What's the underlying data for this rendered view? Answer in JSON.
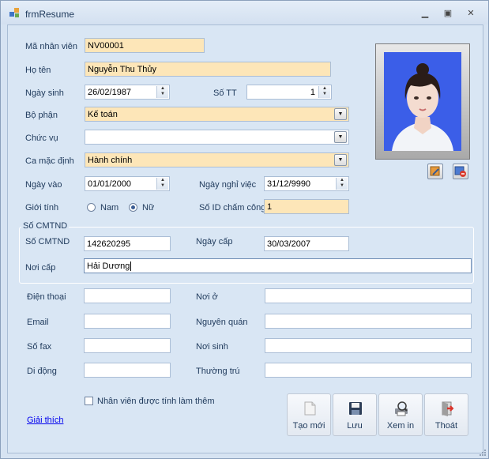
{
  "window": {
    "title": "frmResume"
  },
  "form": {
    "ma_nhan_vien": {
      "label": "Mã nhân viên",
      "value": "NV00001"
    },
    "ho_ten": {
      "label": "Họ tên",
      "value": "Nguyễn Thu Thủy"
    },
    "ngay_sinh": {
      "label": "Ngày sinh",
      "value": "26/02/1987"
    },
    "so_tt": {
      "label": "Số TT",
      "value": "1"
    },
    "bo_phan": {
      "label": "Bộ phận",
      "value": "Kế toán"
    },
    "chuc_vu": {
      "label": "Chức vụ",
      "value": ""
    },
    "ca_mac_dinh": {
      "label": "Ca mặc định",
      "value": "Hành chính"
    },
    "ngay_vao": {
      "label": "Ngày vào",
      "value": "01/01/2000"
    },
    "ngay_nghi_viec": {
      "label": "Ngày nghỉ việc",
      "value": "31/12/9990"
    },
    "gioi_tinh": {
      "label": "Giới tính",
      "options": [
        "Nam",
        "Nữ"
      ],
      "selected": "Nữ"
    },
    "so_id_cham_cong": {
      "label": "Số ID chấm công",
      "value": "1"
    }
  },
  "cmtnd_group": {
    "title": "Số CMTND",
    "so_cmtnd": {
      "label": "Số CMTND",
      "value": "142620295"
    },
    "ngay_cap": {
      "label": "Ngày cấp",
      "value": "30/03/2007"
    },
    "noi_cap": {
      "label": "Nơi cấp",
      "value": "Hải Dương"
    }
  },
  "contact": {
    "dien_thoai": {
      "label": "Điện thoại",
      "value": ""
    },
    "noi_o": {
      "label": "Nơi ở",
      "value": ""
    },
    "email": {
      "label": "Email",
      "value": ""
    },
    "nguyen_quan": {
      "label": "Nguyên quán",
      "value": ""
    },
    "so_fax": {
      "label": "Số fax",
      "value": ""
    },
    "noi_sinh": {
      "label": "Nơi sinh",
      "value": ""
    },
    "di_dong": {
      "label": "Di động",
      "value": ""
    },
    "thuong_tru": {
      "label": "Thường trú",
      "value": ""
    }
  },
  "overtime_checkbox": {
    "label": "Nhân viên được tính làm thêm",
    "checked": false
  },
  "help_link": "Giải thích",
  "toolbar": {
    "new_label": "Tạo mới",
    "save_label": "Lưu",
    "view_label": "Xem in",
    "exit_label": "Thoát"
  },
  "colors": {
    "required_field": "#fde6b8",
    "link": "#0000ee",
    "photo_bg": "#3b5ee8"
  }
}
